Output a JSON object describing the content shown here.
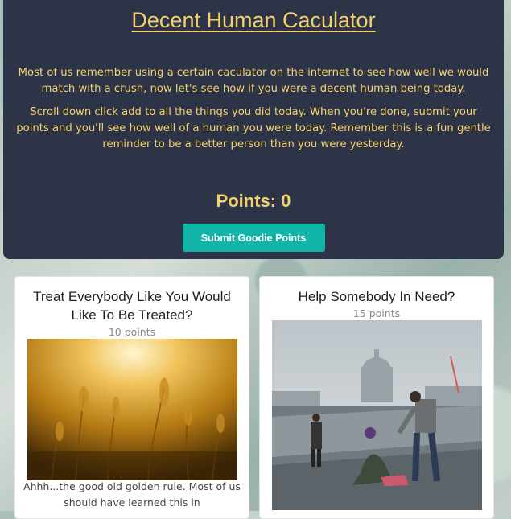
{
  "header": {
    "title": "Decent Human Caculator",
    "intro": "Most of us remember using a certain caculator on the internet to see how well we would match with a crush, now let's see how if you were a decent human being today.",
    "instructions": "Scroll down click add to all the things you did today. When you're done, submit your points and you'll see how well of a human you were today. Remember this is a fun gentle reminder to be a better person than you were yesterday.",
    "points_label": "Points: 0",
    "submit_label": "Submit Goodie Points"
  },
  "cards": [
    {
      "title": "Treat Everybody Like You Would Like To Be Treated?",
      "points": "10 points",
      "description": "Ahhh...the good old golden rule. Most of us should have learned this in"
    },
    {
      "title": "Help Somebody In Need?",
      "points": "15 points"
    }
  ],
  "colors": {
    "header_bg": "#2d3447",
    "header_text": "#f4d26b",
    "button_bg": "#12b4a8"
  }
}
